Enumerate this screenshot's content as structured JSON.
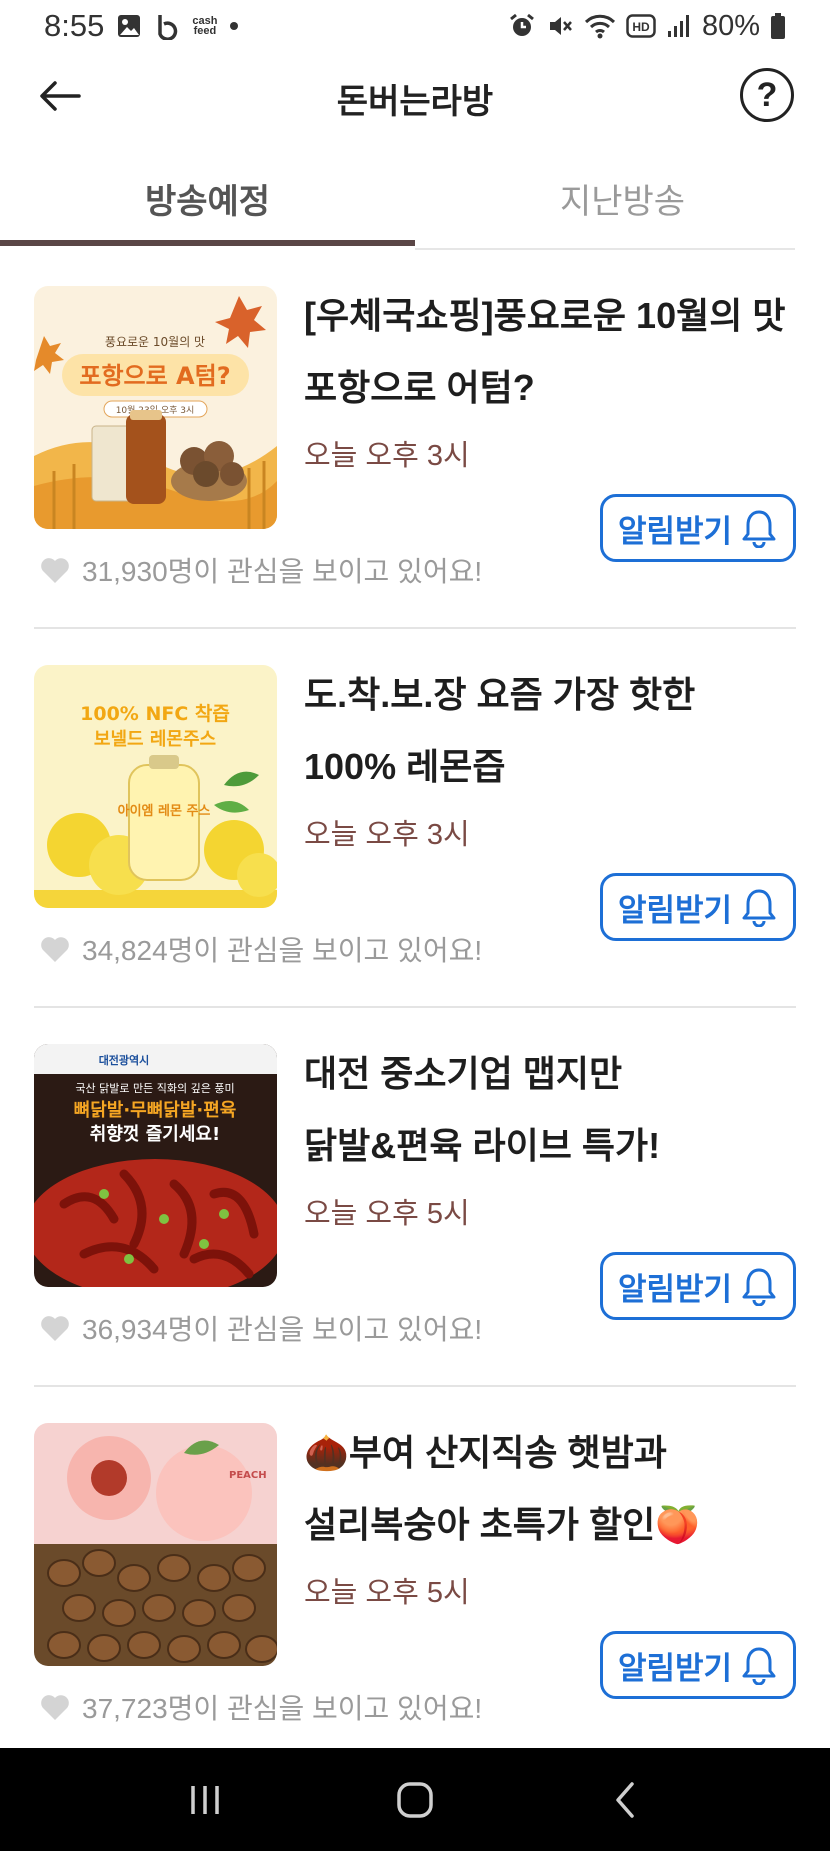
{
  "status_bar": {
    "time": "8:55",
    "battery": "80%",
    "cash_line1": "cash",
    "cash_line2": "feed",
    "icons": [
      "gallery-icon",
      "b-app-icon",
      "cashfeed-icon",
      "dot-icon",
      "alarm-icon",
      "mute-icon",
      "wifi-icon",
      "hd-icon",
      "signal-icon",
      "battery-icon"
    ]
  },
  "header": {
    "title": "돈버는라방",
    "help": "?"
  },
  "tabs": [
    {
      "label": "방송예정",
      "active": true
    },
    {
      "label": "지난방송",
      "active": false
    }
  ],
  "items": [
    {
      "title": "[우체국쇼핑]풍요로운 10월의 맛\n포항으로 어텀?",
      "time": "오늘 오후 3시",
      "notify_label": "알림받기",
      "interest": "31,930명이 관심을 보이고 있어요!",
      "thumb": {
        "top": "풍요로운 10월의 맛",
        "main": "포항으로 A텀?",
        "date": "10월 23일 오후 3시"
      }
    },
    {
      "title": "도.착.보.장 요즘 가장 핫한\n100% 레몬즙",
      "time": "오늘 오후 3시",
      "notify_label": "알림받기",
      "interest": "34,824명이 관심을 보이고 있어요!",
      "thumb": {
        "top": "100% NFC 착즙",
        "main": "보넬드 레몬주스",
        "bottle": "아이엠 레몬 주스"
      }
    },
    {
      "title": "대전 중소기업 맵지만\n닭발&편육 라이브 특가!",
      "time": "오늘 오후 5시",
      "notify_label": "알림받기",
      "interest": "36,934명이 관심을 보이고 있어요!",
      "thumb": {
        "brand": "대전광역시",
        "sub": "국산 닭발로 만든 직화의 깊은 풍미",
        "main": "뼈닭발·무뼈닭발·편육",
        "main2": "취향껏 즐기세요!"
      }
    },
    {
      "title": "🌰부여 산지직송 햇밤과\n설리복숭아 초특가 할인🍑",
      "time": "오늘 오후 5시",
      "notify_label": "알림받기",
      "interest": "37,723명이 관심을 보이고 있어요!",
      "thumb": {
        "label": "PEACH"
      }
    }
  ],
  "colors": {
    "accent_blue": "#1d6fd6",
    "time_brown": "#7a4a44",
    "tab_underline": "#5a4646",
    "muted_gray": "#9a9a9a"
  }
}
